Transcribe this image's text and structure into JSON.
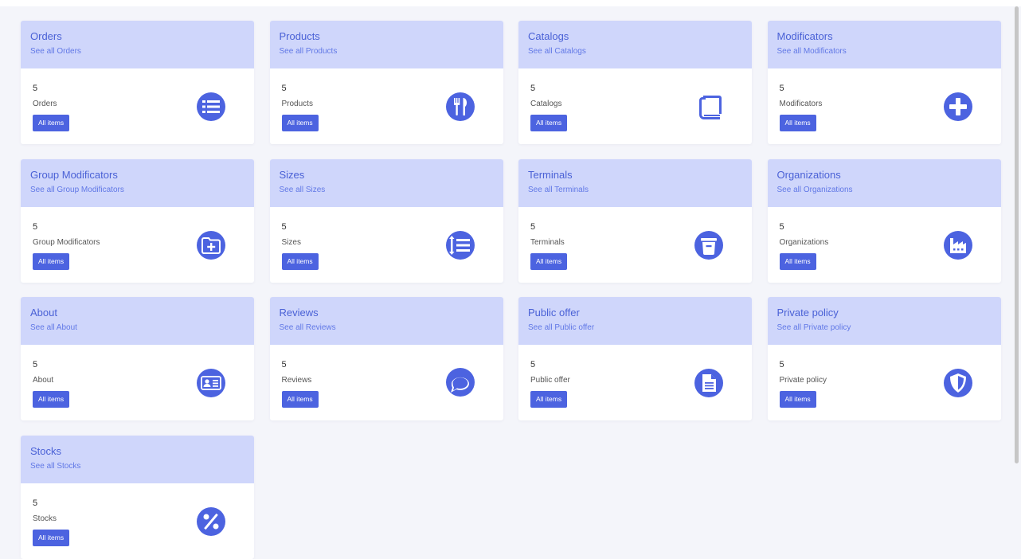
{
  "colors": {
    "accent": "#4c63e0",
    "header_bg": "#cfd6fb",
    "title": "#4a61d6",
    "page_bg": "#f4f5fa"
  },
  "cards": [
    {
      "title": "Orders",
      "link": "See all Orders",
      "count": "5",
      "label": "Orders",
      "button": "All items",
      "icon": "list-icon"
    },
    {
      "title": "Products",
      "link": "See all Products",
      "count": "5",
      "label": "Products",
      "button": "All items",
      "icon": "utensils-icon"
    },
    {
      "title": "Catalogs",
      "link": "See all Catalogs",
      "count": "5",
      "label": "Catalogs",
      "button": "All items",
      "icon": "book-icon"
    },
    {
      "title": "Modificators",
      "link": "See all Modificators",
      "count": "5",
      "label": "Modificators",
      "button": "All items",
      "icon": "plus-circle-icon"
    },
    {
      "title": "Group Modificators",
      "link": "See all Group Modificators",
      "count": "5",
      "label": "Group Modificators",
      "button": "All items",
      "icon": "folder-plus-icon"
    },
    {
      "title": "Sizes",
      "link": "See all Sizes",
      "count": "5",
      "label": "Sizes",
      "button": "All items",
      "icon": "sort-list-icon"
    },
    {
      "title": "Terminals",
      "link": "See all Terminals",
      "count": "5",
      "label": "Terminals",
      "button": "All items",
      "icon": "trash-icon"
    },
    {
      "title": "Organizations",
      "link": "See all Organizations",
      "count": "5",
      "label": "Organizations",
      "button": "All items",
      "icon": "industry-icon"
    },
    {
      "title": "About",
      "link": "See all About",
      "count": "5",
      "label": "About",
      "button": "All items",
      "icon": "id-card-icon"
    },
    {
      "title": "Reviews",
      "link": "See all Reviews",
      "count": "5",
      "label": "Reviews",
      "button": "All items",
      "icon": "comment-icon"
    },
    {
      "title": "Public offer",
      "link": "See all Public offer",
      "count": "5",
      "label": "Public offer",
      "button": "All items",
      "icon": "document-icon"
    },
    {
      "title": "Private policy",
      "link": "See all Private policy",
      "count": "5",
      "label": "Private policy",
      "button": "All items",
      "icon": "shield-icon"
    },
    {
      "title": "Stocks",
      "link": "See all Stocks",
      "count": "5",
      "label": "Stocks",
      "button": "All items",
      "icon": "percent-icon"
    }
  ]
}
